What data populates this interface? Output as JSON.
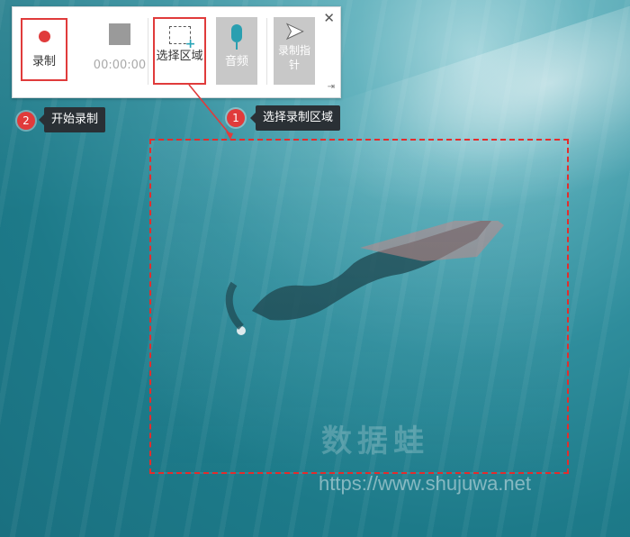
{
  "toolbar": {
    "record_label": "录制",
    "timer": "00:00:00",
    "select_area_label": "选择区域",
    "audio_label": "音频",
    "pointer_label": "录制指针",
    "close_glyph": "✕",
    "pin_glyph": "⇥"
  },
  "callouts": {
    "step1_number": "1",
    "step1_text": "选择录制区域",
    "step2_number": "2",
    "step2_text": "开始录制"
  },
  "watermark": {
    "site_name": "数据蛙",
    "url": "https://www.shujuwa.net"
  },
  "colors": {
    "accent_red": "#e03b3b",
    "tooltip_bg": "#2a3035",
    "mic_blue": "#2a9fb0"
  }
}
